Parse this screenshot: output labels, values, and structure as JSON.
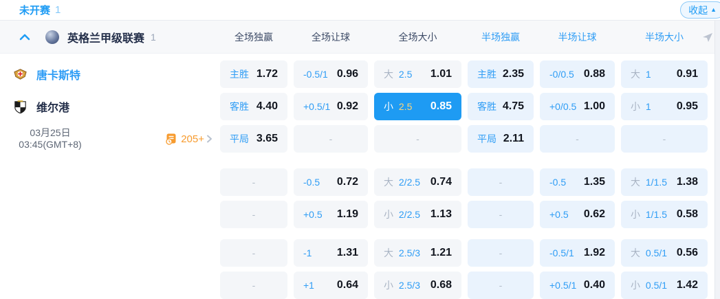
{
  "colors": {
    "accent": "#1f9cf4",
    "selected_cell_bg": "#1e9bf3",
    "selected_line": "#ffd478",
    "full_cell_bg": "#f4f6f9",
    "half_cell_bg": "#eaf3fd",
    "markets_orange": "#f79b2e"
  },
  "topbar": {
    "status_label": "未开赛",
    "status_count": "1",
    "collapse_label": "收起"
  },
  "league_header": {
    "name": "英格兰甲级联赛",
    "count": "1",
    "columns": [
      {
        "label": "全场独赢",
        "scope": "full"
      },
      {
        "label": "全场让球",
        "scope": "full"
      },
      {
        "label": "全场大小",
        "scope": "full"
      },
      {
        "label": "半场独赢",
        "scope": "half"
      },
      {
        "label": "半场让球",
        "scope": "half"
      },
      {
        "label": "半场大小",
        "scope": "half"
      }
    ]
  },
  "match": {
    "home_name": "唐卡斯特",
    "away_name": "维尔港",
    "date_line1": "03月25日",
    "date_line2": "03:45(GMT+8)",
    "markets_count": "205+"
  },
  "odds": {
    "groups": [
      {
        "rows": [
          [
            {
              "label": "主胜",
              "value": "1.72"
            },
            {
              "label": "-0.5/1",
              "value": "0.96"
            },
            {
              "prefix": "大",
              "line": "2.5",
              "value": "1.01"
            },
            {
              "label": "主胜",
              "value": "2.35"
            },
            {
              "label": "-0/0.5",
              "value": "0.88"
            },
            {
              "prefix": "大",
              "line": "1",
              "value": "0.91"
            }
          ],
          [
            {
              "label": "客胜",
              "value": "4.40"
            },
            {
              "label": "+0.5/1",
              "value": "0.92"
            },
            {
              "prefix": "小",
              "line": "2.5",
              "value": "0.85",
              "selected": true
            },
            {
              "label": "客胜",
              "value": "4.75"
            },
            {
              "label": "+0/0.5",
              "value": "1.00"
            },
            {
              "prefix": "小",
              "line": "1",
              "value": "0.95"
            }
          ],
          [
            {
              "label": "平局",
              "value": "3.65"
            },
            null,
            null,
            {
              "label": "平局",
              "value": "2.11"
            },
            null,
            null
          ]
        ]
      },
      {
        "rows": [
          [
            null,
            {
              "label": "-0.5",
              "value": "0.72"
            },
            {
              "prefix": "大",
              "line": "2/2.5",
              "value": "0.74"
            },
            null,
            {
              "label": "-0.5",
              "value": "1.35"
            },
            {
              "prefix": "大",
              "line": "1/1.5",
              "value": "1.38"
            }
          ],
          [
            null,
            {
              "label": "+0.5",
              "value": "1.19"
            },
            {
              "prefix": "小",
              "line": "2/2.5",
              "value": "1.13"
            },
            null,
            {
              "label": "+0.5",
              "value": "0.62"
            },
            {
              "prefix": "小",
              "line": "1/1.5",
              "value": "0.58"
            }
          ]
        ]
      },
      {
        "rows": [
          [
            null,
            {
              "label": "-1",
              "value": "1.31"
            },
            {
              "prefix": "大",
              "line": "2.5/3",
              "value": "1.21"
            },
            null,
            {
              "label": "-0.5/1",
              "value": "1.92"
            },
            {
              "prefix": "大",
              "line": "0.5/1",
              "value": "0.56"
            }
          ],
          [
            null,
            {
              "label": "+1",
              "value": "0.64"
            },
            {
              "prefix": "小",
              "line": "2.5/3",
              "value": "0.68"
            },
            null,
            {
              "label": "+0.5/1",
              "value": "0.40"
            },
            {
              "prefix": "小",
              "line": "0.5/1",
              "value": "1.42"
            }
          ]
        ]
      }
    ],
    "empty_placeholder": "-"
  }
}
